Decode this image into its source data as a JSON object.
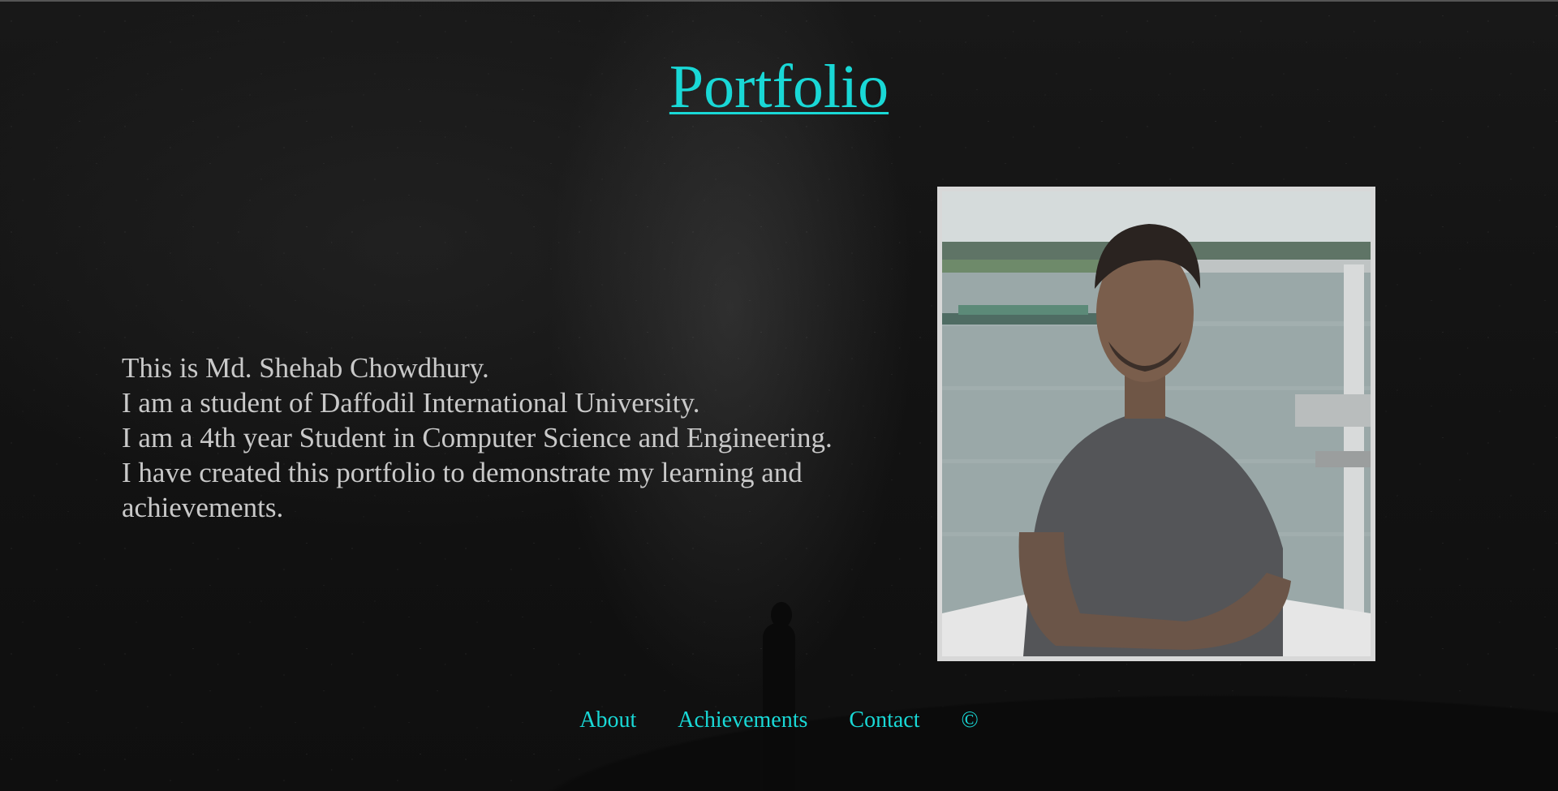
{
  "header": {
    "title": "Portfolio"
  },
  "intro": {
    "lines": [
      "This is Md. Shehab Chowdhury.",
      "I am a student of Daffodil International University.",
      "I am a 4th year Student in Computer Science and Engineering.",
      "I have created this portfolio to demonstrate my learning and achievements."
    ]
  },
  "profile_photo": {
    "icon": "profile-photo"
  },
  "nav": {
    "items": [
      {
        "label": "About"
      },
      {
        "label": "Achievements"
      },
      {
        "label": "Contact"
      },
      {
        "label": "©"
      }
    ]
  },
  "colors": {
    "accent": "#19d8d6",
    "text": "#c9c9c9",
    "background": "#131313"
  }
}
